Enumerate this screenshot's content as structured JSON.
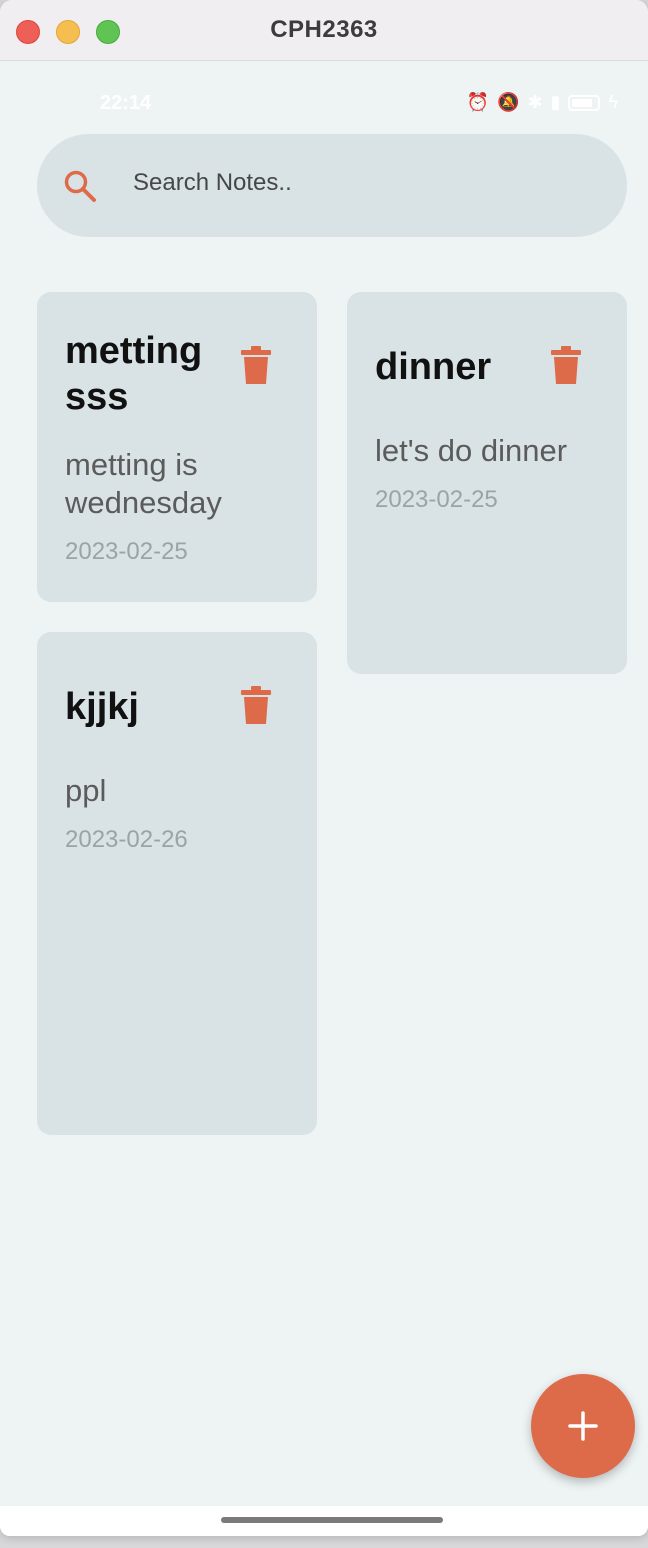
{
  "window": {
    "title": "CPH2363"
  },
  "status_bar": {
    "time": "22:14"
  },
  "search": {
    "placeholder": "Search Notes.."
  },
  "notes": [
    {
      "title": "metting sss",
      "body": "metting is wednesday",
      "date": "2023-02-25"
    },
    {
      "title": "dinner",
      "body": "let's do dinner",
      "date": "2023-02-25"
    },
    {
      "title": "kjjkj",
      "body": "ppl",
      "date": "2023-02-26"
    }
  ],
  "colors": {
    "accent": "#dd6b4a",
    "card_background": "#d9e3e5",
    "app_background": "#eef4f4"
  },
  "icons": {
    "search": "search-icon",
    "delete": "trash-icon",
    "add": "plus-icon"
  }
}
